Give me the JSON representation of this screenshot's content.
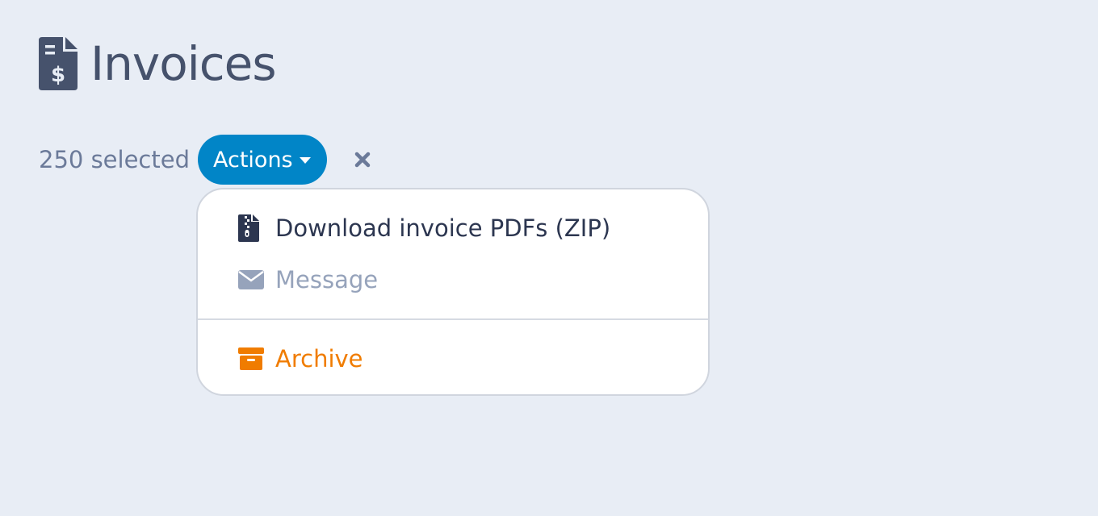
{
  "page": {
    "title": "Invoices",
    "title_icon": "file-invoice-dollar-icon"
  },
  "selection": {
    "count_label": "250 selected",
    "actions_label": "Actions",
    "clear_icon": "close-icon"
  },
  "menu": {
    "items": [
      {
        "label": "Download invoice PDFs (ZIP)",
        "icon": "file-zipper-icon",
        "state": "enabled"
      },
      {
        "label": "Message",
        "icon": "envelope-icon",
        "state": "disabled"
      },
      {
        "label": "Archive",
        "icon": "archive-box-icon",
        "state": "danger"
      }
    ]
  },
  "colors": {
    "background": "#e8edf5",
    "primary": "#0185c7",
    "text": "#46526c",
    "muted": "#96a3bb",
    "warning": "#f07c00"
  }
}
